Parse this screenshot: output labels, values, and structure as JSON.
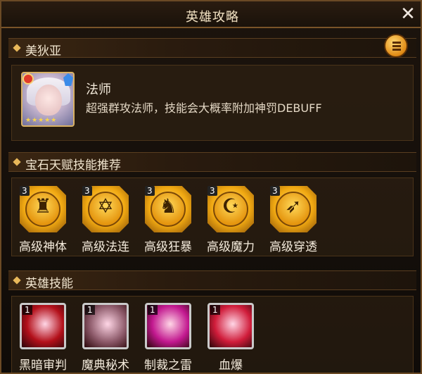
{
  "window": {
    "title": "英雄攻略"
  },
  "hero_section": {
    "header": "美狄亚",
    "hero": {
      "class_label": "法师",
      "description": "超强群攻法师，技能会大概率附加神罚DEBUFF",
      "stars": "★★★★★"
    }
  },
  "talent_section": {
    "header": "宝石天赋技能推荐",
    "items": [
      {
        "label": "高级神体",
        "level": "3",
        "icon": "figure-icon",
        "glyph": "♜"
      },
      {
        "label": "高级法连",
        "level": "3",
        "icon": "hexagram-icon",
        "glyph": "✡"
      },
      {
        "label": "高级狂暴",
        "level": "3",
        "icon": "rage-icon",
        "glyph": "♞"
      },
      {
        "label": "高级魔力",
        "level": "3",
        "icon": "crescent-icon",
        "glyph": "☪"
      },
      {
        "label": "高级穿透",
        "level": "3",
        "icon": "pierce-icon",
        "glyph": "➶"
      }
    ]
  },
  "skill_section": {
    "header": "英雄技能",
    "items": [
      {
        "label": "黑暗审判",
        "level": "1",
        "icon": "dark-slash-icon",
        "bg": "#b3101a"
      },
      {
        "label": "魔典秘术",
        "level": "1",
        "icon": "spellbook-icon",
        "bg": "#8d5a6a"
      },
      {
        "label": "制裁之雷",
        "level": "1",
        "icon": "thunder-icon",
        "bg": "#c2188f"
      },
      {
        "label": "血爆",
        "level": "1",
        "icon": "blood-burst-icon",
        "bg": "#d01c3a"
      }
    ]
  },
  "colors": {
    "accent_gold": "#e8b85a",
    "frame_border": "#6b4a25",
    "text_light": "#f3e3c4"
  }
}
